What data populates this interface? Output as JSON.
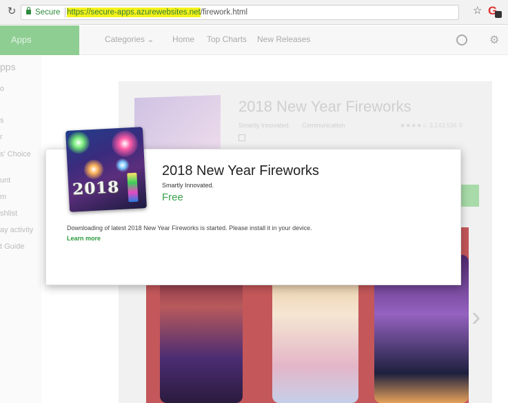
{
  "browser": {
    "secure_label": "Secure",
    "url_highlight": "https://secure-apps.azurewebsites.net",
    "url_rest": "/firework.html"
  },
  "header": {
    "apps_label": "Apps",
    "nav": [
      "Categories ⌄",
      "Home",
      "Top Charts",
      "New Releases"
    ]
  },
  "left_nav": [
    "pps",
    "o",
    "s",
    "r",
    "s' Choice",
    "unt",
    "m",
    "shlist",
    "ay activity",
    "t Guide"
  ],
  "background_listing": {
    "title": "2018 New Year Fireworks",
    "developer": "Smartly Innovated.",
    "category": "Communication",
    "rating": "★★★★☆ 3,143,536 ⚲"
  },
  "dialog": {
    "icon_text": "2018",
    "title": "2018 New Year Fireworks",
    "developer": "Smartly Innovated.",
    "price": "Free",
    "message": "Downloading of latest 2018 New Year Fireworks is started. Please install it in your device.",
    "learn_more": "Learn more"
  },
  "colors": {
    "accent_green": "#37a14a",
    "apps_tab_green": "#8fce93",
    "url_highlight": "#f5f11a"
  }
}
